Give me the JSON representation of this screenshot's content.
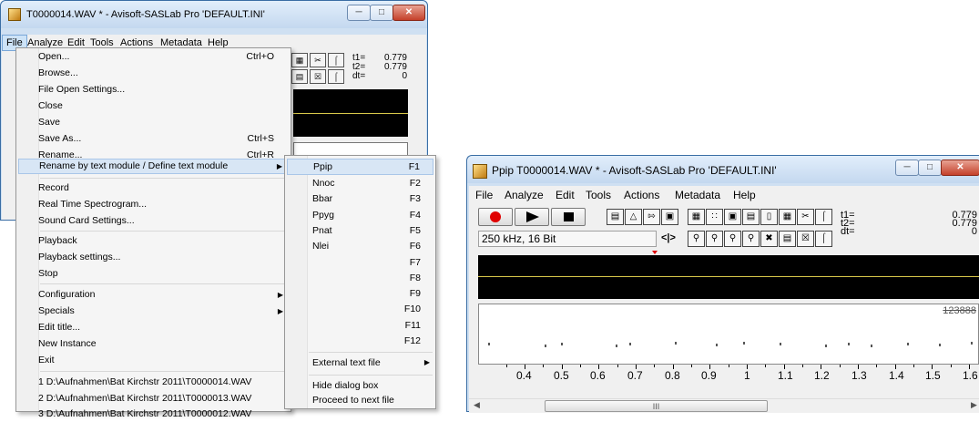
{
  "left_window": {
    "title": "T0000014.WAV * - Avisoft-SASLab Pro  'DEFAULT.INI'",
    "menu": [
      "File",
      "Analyze",
      "Edit",
      "Tools",
      "Actions",
      "Metadata",
      "Help"
    ],
    "t_labels": [
      "t1=",
      "t2=",
      "dt="
    ],
    "t_values": [
      "0.779",
      "0.779",
      "0"
    ]
  },
  "file_menu": {
    "items": [
      {
        "label": "Open...",
        "shortcut": "Ctrl+O"
      },
      {
        "label": "Browse...",
        "shortcut": ""
      },
      {
        "label": "File Open Settings...",
        "shortcut": ""
      },
      {
        "label": "Close",
        "shortcut": ""
      },
      {
        "label": "Save",
        "shortcut": ""
      },
      {
        "label": "Save As...",
        "shortcut": "Ctrl+S"
      },
      {
        "label": "Rename...",
        "shortcut": "Ctrl+R"
      },
      {
        "label": "Rename by text module / Define text module",
        "shortcut": ""
      },
      {
        "label": "Record",
        "shortcut": ""
      },
      {
        "label": "Real Time Spectrogram...",
        "shortcut": ""
      },
      {
        "label": "Sound Card Settings...",
        "shortcut": ""
      },
      {
        "label": "Playback",
        "shortcut": ""
      },
      {
        "label": "Playback settings...",
        "shortcut": ""
      },
      {
        "label": "Stop",
        "shortcut": ""
      },
      {
        "label": "Configuration",
        "shortcut": ""
      },
      {
        "label": "Specials",
        "shortcut": ""
      },
      {
        "label": "Edit title...",
        "shortcut": ""
      },
      {
        "label": "New Instance",
        "shortcut": ""
      },
      {
        "label": "Exit",
        "shortcut": ""
      },
      {
        "label": "1 D:\\Aufnahmen\\Bat Kirchstr 2011\\T0000014.WAV",
        "shortcut": ""
      },
      {
        "label": "2 D:\\Aufnahmen\\Bat Kirchstr 2011\\T0000013.WAV",
        "shortcut": ""
      },
      {
        "label": "3 D:\\Aufnahmen\\Bat Kirchstr 2011\\T0000012.WAV",
        "shortcut": ""
      }
    ]
  },
  "text_module_menu": {
    "items": [
      {
        "label": "Ppip",
        "shortcut": "F1"
      },
      {
        "label": "Nnoc",
        "shortcut": "F2"
      },
      {
        "label": "Bbar",
        "shortcut": "F3"
      },
      {
        "label": "Ppyg",
        "shortcut": "F4"
      },
      {
        "label": "Pnat",
        "shortcut": "F5"
      },
      {
        "label": "Nlei",
        "shortcut": "F6"
      },
      {
        "label": "",
        "shortcut": "F7"
      },
      {
        "label": "",
        "shortcut": "F8"
      },
      {
        "label": "",
        "shortcut": "F9"
      },
      {
        "label": "",
        "shortcut": "F10"
      },
      {
        "label": "",
        "shortcut": "F11"
      },
      {
        "label": "",
        "shortcut": "F12"
      },
      {
        "label": "External text file",
        "shortcut": ""
      },
      {
        "label": "Hide dialog box",
        "shortcut": ""
      },
      {
        "label": "Proceed to next file",
        "shortcut": ""
      }
    ]
  },
  "right_window": {
    "title": "Ppip T0000014.WAV * - Avisoft-SASLab Pro  'DEFAULT.INI'",
    "menu": [
      "File",
      "Analyze",
      "Edit",
      "Tools",
      "Actions",
      "Metadata",
      "Help"
    ],
    "format": "250 kHz, 16 Bit",
    "t_labels": [
      "t1=",
      "t2=",
      "dt="
    ],
    "t_values": [
      "0.779",
      "0.779",
      "0"
    ],
    "spectrogram_max": "123888",
    "time_axis": [
      "0.4",
      "0.5",
      "0.6",
      "0.7",
      "0.8",
      "0.9",
      "1",
      "1.1",
      "1.2",
      "1.3",
      "1.4",
      "1.5",
      "1.6"
    ],
    "scroll_grip": "III"
  },
  "colors": {
    "record_red": "#e00000",
    "cursor_line": "#d8c84a",
    "highlight": "#d8e6f5"
  }
}
